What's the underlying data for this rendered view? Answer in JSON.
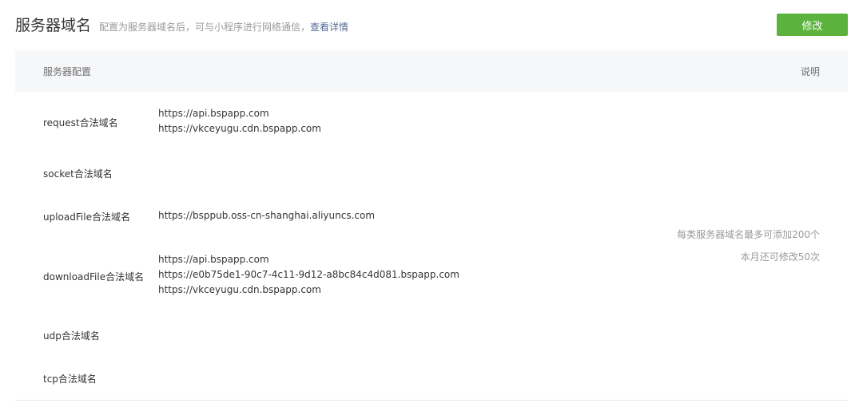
{
  "header": {
    "title": "服务器域名",
    "description": "配置为服务器域名后，可与小程序进行网络通信，",
    "details_link": "查看详情",
    "edit_button": "修改"
  },
  "table": {
    "col_config": "服务器配置",
    "col_desc": "说明",
    "rows": [
      {
        "label": "request合法域名",
        "values": [
          "https://api.bspapp.com",
          "https://vkceyugu.cdn.bspapp.com"
        ]
      },
      {
        "label": "socket合法域名",
        "values": []
      },
      {
        "label": "uploadFile合法域名",
        "values": [
          "https://bsppub.oss-cn-shanghai.aliyuncs.com"
        ]
      },
      {
        "label": "downloadFile合法域名",
        "values": [
          "https://api.bspapp.com",
          "https://e0b75de1-90c7-4c11-9d12-a8bc84c4d081.bspapp.com",
          "https://vkceyugu.cdn.bspapp.com"
        ]
      },
      {
        "label": "udp合法域名",
        "values": []
      },
      {
        "label": "tcp合法域名",
        "values": []
      }
    ],
    "notes": [
      "每类服务器域名最多可添加200个",
      "本月还可修改50次"
    ]
  }
}
